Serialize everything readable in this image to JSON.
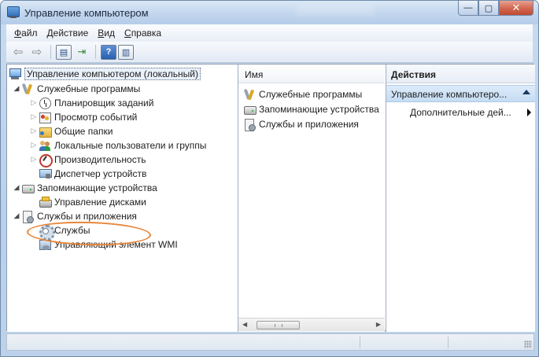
{
  "window": {
    "title": "Управление компьютером",
    "buttons": {
      "minimize": "—",
      "maximize": "▢",
      "close": "✕"
    }
  },
  "menu": [
    {
      "underline": "Ф",
      "rest": "айл"
    },
    {
      "underline": "Д",
      "rest": "ействие"
    },
    {
      "underline": "В",
      "rest": "ид"
    },
    {
      "underline": "С",
      "rest": "правка"
    }
  ],
  "toolbar": {
    "back_icon": "back-arrow-icon",
    "forward_icon": "forward-arrow-icon",
    "help_glyph": "?"
  },
  "tree": {
    "root": "Управление компьютером (локальный)",
    "system_tools": "Служебные программы",
    "task_scheduler": "Планировщик заданий",
    "event_viewer": "Просмотр событий",
    "shared_folders": "Общие папки",
    "local_users": "Локальные пользователи и группы",
    "performance": "Производительность",
    "device_manager": "Диспетчер устройств",
    "storage": "Запоминающие устройства",
    "disk_management": "Управление дисками",
    "services_apps": "Службы и приложения",
    "services": "Службы",
    "wmi": "Управляющий элемент WMI"
  },
  "list": {
    "header": "Имя",
    "items": [
      "Служебные программы",
      "Запоминающие устройства",
      "Службы и приложения"
    ]
  },
  "actions": {
    "header": "Действия",
    "section": "Управление компьютеро...",
    "more": "Дополнительные дей..."
  },
  "colors": {
    "highlight_ellipse": "#e9863a",
    "actions_section_bg": "#c5dcf3"
  }
}
